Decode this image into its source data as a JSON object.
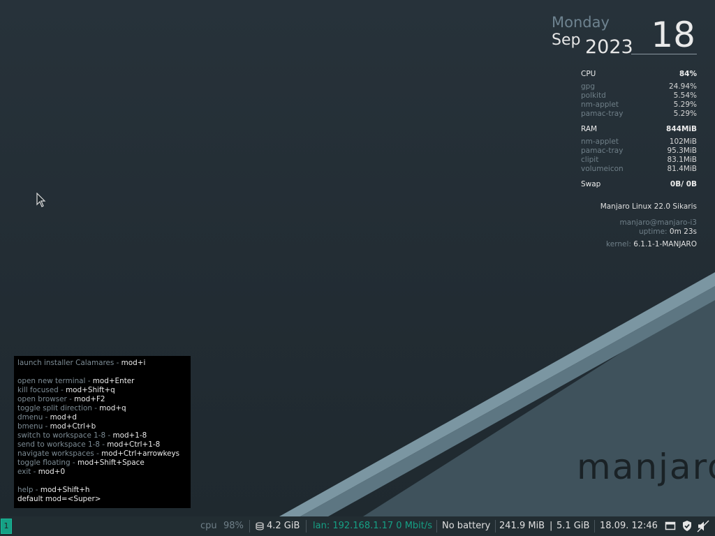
{
  "date": {
    "weekday": "Monday",
    "month": "Sep",
    "year": "2023",
    "day": "18"
  },
  "stats": {
    "cpu": {
      "label": "CPU",
      "value": "84%",
      "processes": [
        {
          "name": "gpg",
          "value": "24.94%"
        },
        {
          "name": "polkitd",
          "value": "5.54%"
        },
        {
          "name": "nm-applet",
          "value": "5.29%"
        },
        {
          "name": "pamac-tray",
          "value": "5.29%"
        }
      ]
    },
    "ram": {
      "label": "RAM",
      "value": "844MiB",
      "processes": [
        {
          "name": "nm-applet",
          "value": "102MiB"
        },
        {
          "name": "pamac-tray",
          "value": "95.3MiB"
        },
        {
          "name": "clipit",
          "value": "83.1MiB"
        },
        {
          "name": "volumeicon",
          "value": "81.4MiB"
        }
      ]
    },
    "swap": {
      "label": "Swap",
      "value": "0B/ 0B"
    }
  },
  "system": {
    "distro": "Manjaro Linux 22.0 Sikaris",
    "user_host": "manjaro@manjaro-i3",
    "uptime_label": "uptime:",
    "uptime_value": "0m 23s",
    "kernel_label": "kernel:",
    "kernel_value": "6.1.1-1-MANJARO"
  },
  "help": [
    {
      "desc": "launch installer Calamares - ",
      "shortcut": "mod+i"
    },
    {
      "blank": true
    },
    {
      "desc": "open new terminal - ",
      "shortcut": "mod+Enter"
    },
    {
      "desc": "kill focused - ",
      "shortcut": "mod+Shift+q"
    },
    {
      "desc": "open browser - ",
      "shortcut": "mod+F2"
    },
    {
      "desc": "toggle split direction - ",
      "shortcut": "mod+q"
    },
    {
      "desc": "dmenu - ",
      "shortcut": "mod+d"
    },
    {
      "desc": "bmenu - ",
      "shortcut": "mod+Ctrl+b"
    },
    {
      "desc": "switch to workspace 1-8 - ",
      "shortcut": "mod+1-8"
    },
    {
      "desc": "send to workspace 1-8 - ",
      "shortcut": "mod+Ctrl+1-8"
    },
    {
      "desc": "navigate workspaces - ",
      "shortcut": "mod+Ctrl+arrowkeys"
    },
    {
      "desc": "toggle floating - ",
      "shortcut": "mod+Shift+Space"
    },
    {
      "desc": "exit - ",
      "shortcut": "mod+0"
    },
    {
      "blank": true
    },
    {
      "desc": "help - ",
      "shortcut": "mod+Shift+h"
    },
    {
      "desc": "",
      "shortcut": "default mod=<Super>"
    }
  ],
  "wallpaper": {
    "logo_text": "manjaro"
  },
  "bar": {
    "workspace": "1",
    "cpu_label": "cpu",
    "cpu_value": "98%",
    "disk_value": "4.2 GiB",
    "lan": "lan: 192.168.1.17 0 Mbit/s",
    "battery": "No battery",
    "mem_used": "241.9 MiB",
    "mem_sep": "|",
    "mem_total": "5.1 GiB",
    "datetime": "18.09. 12:46",
    "tray_icons": [
      "clipboard-icon",
      "shield-icon",
      "volume-muted-icon"
    ]
  },
  "colors": {
    "accent": "#16a085",
    "background": "#222d32",
    "muted": "#6f7f88"
  }
}
